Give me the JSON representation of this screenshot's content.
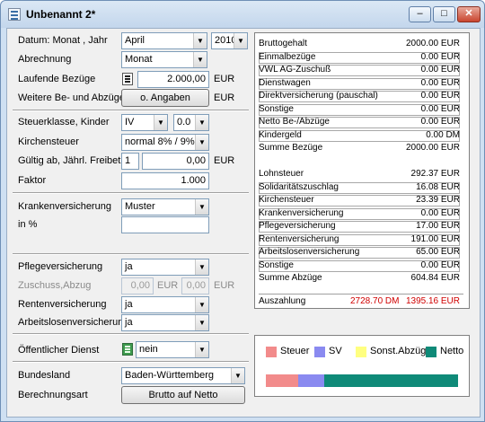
{
  "window": {
    "title": "Unbenannt 2*",
    "min_label": "–",
    "max_label": "□",
    "close_label": "✕"
  },
  "form": {
    "datum_label": "Datum: Monat , Jahr",
    "month_value": "April",
    "year_value": "2010",
    "abrechnung_label": "Abrechnung",
    "abrechnung_value": "Monat",
    "laufende_label": "Laufende Bezüge",
    "laufende_value": "2.000,00",
    "laufende_unit": "EUR",
    "weitere_label": "Weitere Be- und Abzüge",
    "weitere_button": "o. Angaben",
    "weitere_unit": "EUR",
    "steuerklasse_label": "Steuerklasse, Kinder",
    "steuerklasse_value": "IV",
    "kinder_value": "0.0",
    "kirchensteuer_label": "Kirchensteuer",
    "kirchensteuer_value": "normal 8% / 9%",
    "freibetrag_label": "Gültig ab, Jährl. Freibetrag",
    "freibetrag_from": "1",
    "freibetrag_value": "0,00",
    "freibetrag_unit": "EUR",
    "faktor_label": "Faktor",
    "faktor_value": "1.000",
    "kv_label": "Krankenversicherung",
    "kv_value": "Muster",
    "inpct_label": "in %",
    "inpct_value": "",
    "pv_label": "Pflegeversicherung",
    "pv_value": "ja",
    "zuschuss_label": "Zuschuss,Abzug",
    "zuschuss_value1": "0,00",
    "zuschuss_unit": "EUR",
    "zuschuss_value2": "0,00",
    "zuschuss_unit2": "EUR",
    "rv_label": "Rentenversicherung",
    "rv_value": "ja",
    "av_label": "Arbeitslosenversicherung",
    "av_value": "ja",
    "od_label": "Öffentlicher Dienst",
    "od_value": "nein",
    "bundesland_label": "Bundesland",
    "bundesland_value": "Baden-Württemberg",
    "berechnungsart_label": "Berechnungsart",
    "berechnungsart_button": "Brutto auf Netto"
  },
  "results": {
    "rows": [
      {
        "label": "Bruttogehalt",
        "value": "2000.00 EUR"
      },
      {
        "label": "Einmalbezüge",
        "value": "0.00 EUR"
      },
      {
        "label": "VWL AG-Zuschuß",
        "value": "0.00 EUR"
      },
      {
        "label": "Dienstwagen",
        "value": "0.00 EUR"
      },
      {
        "label": "Direktversicherung (pauschal)",
        "value": "0.00 EUR"
      },
      {
        "label": "Sonstige",
        "value": "0.00 EUR"
      },
      {
        "label": "Netto Be-/Abzüge",
        "value": "0.00 EUR"
      },
      {
        "label": "Kindergeld",
        "value": "0.00 DM"
      },
      {
        "label": "Summe Bezüge",
        "value": "2000.00 EUR"
      }
    ],
    "deductions": [
      {
        "label": "Lohnsteuer",
        "value": "292.37 EUR"
      },
      {
        "label": "Solidaritätszuschlag",
        "value": "16.08 EUR"
      },
      {
        "label": "Kirchensteuer",
        "value": "23.39 EUR"
      },
      {
        "label": "Krankenversicherung",
        "value": "0.00 EUR"
      },
      {
        "label": "Pflegeversicherung",
        "value": "17.00 EUR"
      },
      {
        "label": "Rentenversicherung",
        "value": "191.00 EUR"
      },
      {
        "label": "Arbeitslosenversicherung",
        "value": "65.00 EUR"
      },
      {
        "label": "Sonstige",
        "value": "0.00 EUR"
      },
      {
        "label": "Summe Abzüge",
        "value": "604.84 EUR"
      }
    ],
    "auszahlung_label": "Auszahlung",
    "auszahlung_dm": "2728.70 DM",
    "auszahlung_eur": "1395.16 EUR",
    "accent_color": "#d00000"
  },
  "chart_data": {
    "type": "bar",
    "categories": [
      "Steuer",
      "SV",
      "Sonst.Abzüge",
      "Netto"
    ],
    "values": [
      331.84,
      273.0,
      0.0,
      1395.16
    ],
    "colors": [
      "#f28b8b",
      "#8a8af0",
      "#ffff80",
      "#0f8a78"
    ],
    "legend_placement": "top"
  }
}
